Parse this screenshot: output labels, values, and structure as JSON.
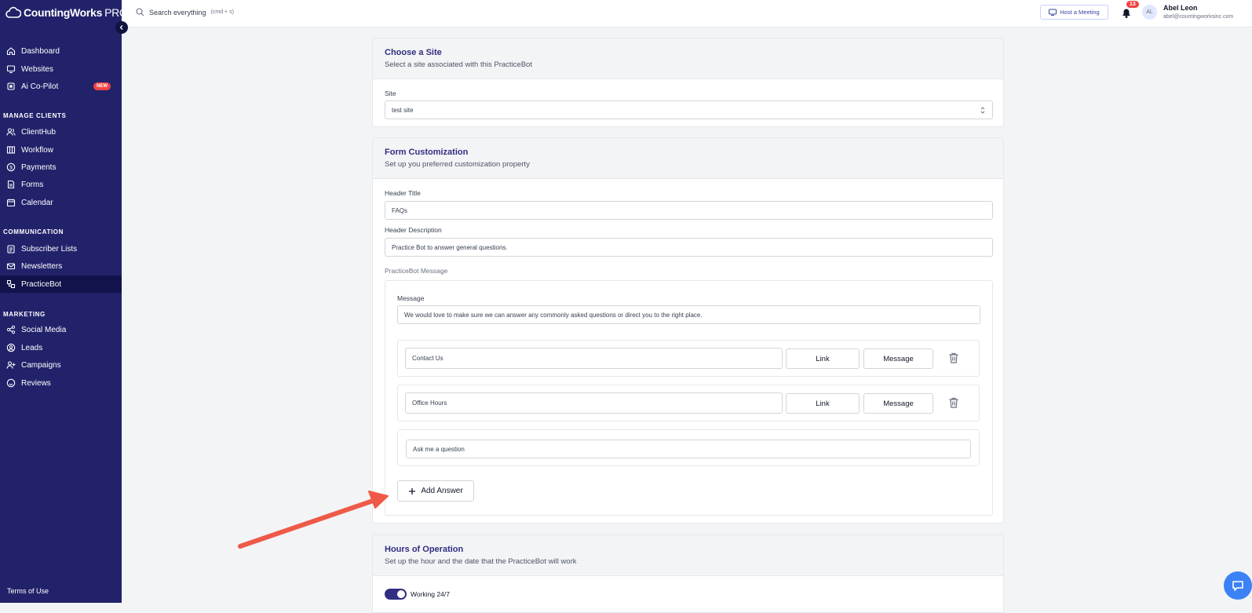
{
  "app": {
    "brand": "CountingWorks",
    "brand_suffix": "PRO"
  },
  "sidebar": {
    "items_top": [
      {
        "label": "Dashboard",
        "icon": "home-icon"
      },
      {
        "label": "Websites",
        "icon": "monitor-icon"
      },
      {
        "label": "Ai Co-Pilot",
        "icon": "ai-icon",
        "badge": "NEW"
      }
    ],
    "sections": [
      {
        "title": "MANAGE CLIENTS",
        "items": [
          "ClientHub",
          "Workflow",
          "Payments",
          "Forms",
          "Calendar"
        ]
      },
      {
        "title": "COMMUNICATION",
        "items": [
          "Subscriber Lists",
          "Newsletters",
          "PracticeBot"
        ]
      },
      {
        "title": "MARKETING",
        "items": [
          "Social Media",
          "Leads",
          "Campaigns",
          "Reviews"
        ]
      }
    ],
    "active": "PracticeBot",
    "footer": "Terms of Use"
  },
  "topbar": {
    "search_placeholder": "Search everything",
    "search_hint": "(cmd + s)",
    "host_meeting": "Host a Meeting",
    "notification_count": "13",
    "avatar_initials": "AL",
    "user_name": "Abel Leon",
    "user_email": "abel@countingworksinc.com"
  },
  "site_card": {
    "title": "Choose a Site",
    "subtitle": "Select a site associated with this PracticeBot",
    "site_label": "Site",
    "site_value": "test site"
  },
  "form_card": {
    "title": "Form Customization",
    "subtitle": "Set up you preferred customization property",
    "header_title_label": "Header Title",
    "header_title_value": "FAQs",
    "header_desc_label": "Header Description",
    "header_desc_value": "Practice Bot to answer general questions.",
    "message_section_label": "PracticeBot Message",
    "message_label": "Message",
    "message_value": "We would love to make sure we can answer any commonly asked questions or direct you to the right place.",
    "answers": [
      {
        "text": "Contact Us",
        "link_label": "Link",
        "message_label": "Message"
      },
      {
        "text": "Office Hours",
        "link_label": "Link",
        "message_label": "Message"
      }
    ],
    "question_placeholder": "Ask me a question",
    "add_answer": "Add Answer"
  },
  "hours_card": {
    "title": "Hours of Operation",
    "subtitle": "Set up the hour and the date that the PracticeBot will work",
    "toggle_label": "Working 24/7",
    "toggle_on": true
  },
  "colors": {
    "sidebar": "#22226b",
    "accent": "#312e81",
    "arrow": "#ef5a48",
    "badge": "#ef4444"
  }
}
